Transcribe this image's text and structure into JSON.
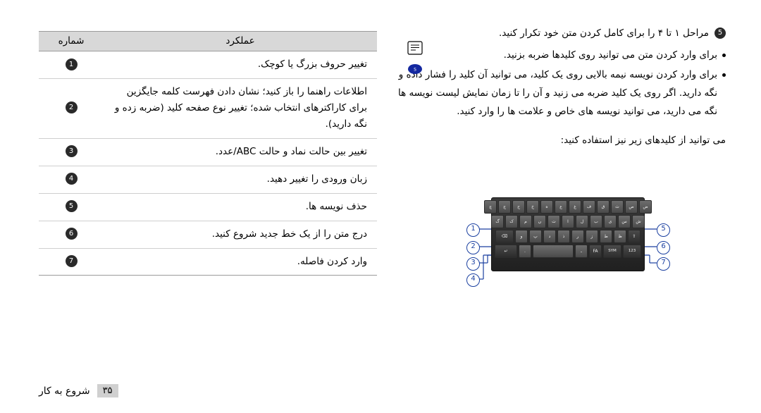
{
  "table": {
    "headers": {
      "number": "شماره",
      "function": "عملکرد"
    },
    "rows": [
      {
        "num": "1",
        "desc": "تغییر حروف بزرگ یا کوچک."
      },
      {
        "num": "2",
        "desc": "اطلاعات راهنما را باز کنید؛ نشان دادن فهرست کلمه جایگزین برای کاراکترهای انتخاب شده؛ تغییر نوع صفحه کلید (ضربه زده و نگه دارید)."
      },
      {
        "num": "3",
        "desc": "تغییر بین حالت نماد و حالت ABC/عدد."
      },
      {
        "num": "4",
        "desc": "زبان ورودی را تغییر دهید."
      },
      {
        "num": "5",
        "desc": "حذف نویسه ها."
      },
      {
        "num": "6",
        "desc": "درج متن را از یک خط جدید شروع کنید."
      },
      {
        "num": "7",
        "desc": "وارد کردن فاصله."
      }
    ]
  },
  "right": {
    "step": {
      "num": "5",
      "text": "مراحل ۱ تا ۴ را برای کامل کردن متن خود تکرار کنید."
    },
    "bullets": [
      "برای وارد کردن متن می توانید روی کلیدها ضربه بزنید.",
      "برای وارد کردن نویسه نیمه بالایی روی یک کلید، می توانید آن کلید را فشار داده و نگه دارید. اگر روی یک کلید ضربه می زنید و آن را تا زمان نمایش لیست نویسه ها نگه می دارید، می توانید نویسه های خاص و علامت ها را وارد کنید."
    ],
    "sub_head": "می توانید از کلیدهای زیر نیز استفاده کنید:"
  },
  "keyboard": {
    "rows": [
      [
        "ض",
        "ص",
        "ث",
        "ق",
        "ف",
        "غ",
        "ع",
        "ه",
        "خ",
        "ح",
        "ج",
        "چ"
      ],
      [
        "ش",
        "س",
        "ی",
        "ب",
        "ل",
        "ا",
        "ت",
        "ن",
        "م",
        "ک",
        "گ"
      ],
      [
        "ظ",
        "ط",
        "ز",
        "ر",
        "ذ",
        "د",
        "پ",
        "و"
      ],
      [
        "۱۲۳",
        "SYM",
        "FA",
        "ـ",
        "،",
        ".",
        "↵"
      ]
    ],
    "shift_key": "⇧",
    "backspace_key": "⌫",
    "enter_key": "↵",
    "space_key": "",
    "sym_key": "SYM",
    "num_key": "123",
    "lang_key": "FA",
    "callouts": [
      "1",
      "2",
      "3",
      "4",
      "5",
      "6",
      "7"
    ]
  },
  "footer": {
    "page": "۳۵",
    "section": "شروع به کار"
  },
  "icons": {
    "note": "note-icon",
    "samsung": "samsung-logo-icon"
  }
}
